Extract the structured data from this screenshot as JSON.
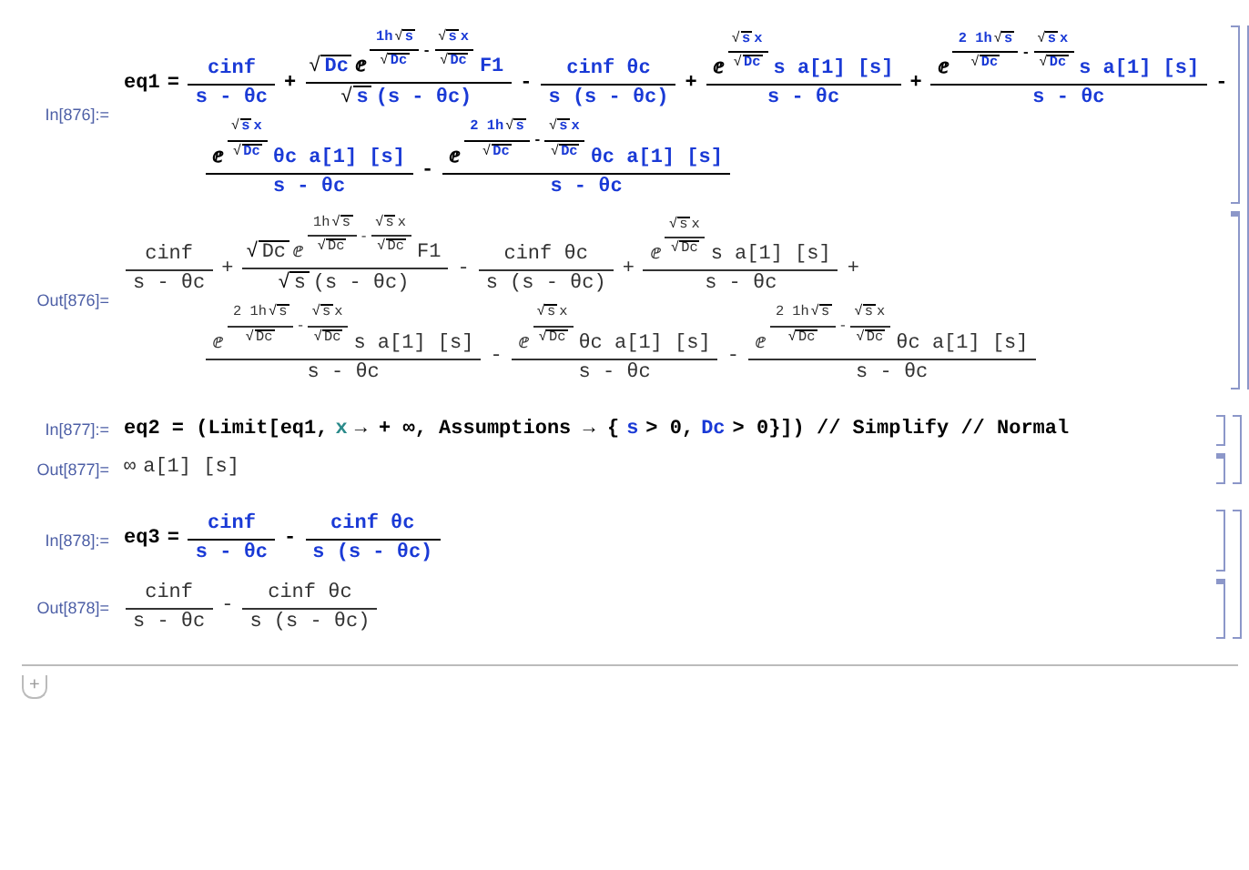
{
  "groups": [
    {
      "cells": [
        {
          "kind": "input",
          "label": "In[876]:=",
          "lines": [
            [
              {
                "op": "eq1"
              },
              {
                "op": "="
              },
              {
                "frac": {
                  "num": [
                    {
                      "var": "cinf"
                    }
                  ],
                  "den": [
                    {
                      "var": "s - θc"
                    }
                  ]
                }
              },
              {
                "op": "+"
              },
              {
                "frac": {
                  "num": [
                    {
                      "sqrt": {
                        "sign": "√",
                        "body": [
                          {
                            "var": "Dc"
                          }
                        ]
                      }
                    },
                    {
                      "power": {
                        "base": [
                          {
                            "op": "ⅇ"
                          }
                        ],
                        "exponent": [
                          {
                            "frac": {
                              "num": [
                                {
                                  "var": "1h"
                                },
                                {
                                  "sqrt": {
                                    "sign": "√",
                                    "body": [
                                      {
                                        "var": "s"
                                      }
                                    ]
                                  }
                                }
                              ],
                              "den": [
                                {
                                  "sqrt": {
                                    "sign": "√",
                                    "body": [
                                      {
                                        "var": "Dc"
                                      }
                                    ]
                                  }
                                }
                              ]
                            }
                          },
                          {
                            "op": "-"
                          },
                          {
                            "frac": {
                              "num": [
                                {
                                  "sqrt": {
                                    "sign": "√",
                                    "body": [
                                      {
                                        "var": "s"
                                      }
                                    ]
                                  }
                                },
                                {
                                  "var": "x"
                                }
                              ],
                              "den": [
                                {
                                  "sqrt": {
                                    "sign": "√",
                                    "body": [
                                      {
                                        "var": "Dc"
                                      }
                                    ]
                                  }
                                }
                              ]
                            }
                          }
                        ]
                      }
                    },
                    {
                      "var": "F1"
                    }
                  ],
                  "den": [
                    {
                      "sqrt": {
                        "sign": "√",
                        "body": [
                          {
                            "var": "s"
                          }
                        ]
                      }
                    },
                    {
                      "var": "(s - θc)"
                    }
                  ]
                }
              },
              {
                "op": "-"
              },
              {
                "frac": {
                  "num": [
                    {
                      "var": "cinf θc"
                    }
                  ],
                  "den": [
                    {
                      "var": "s (s - θc)"
                    }
                  ]
                }
              },
              {
                "op": "+"
              },
              {
                "frac": {
                  "num": [
                    {
                      "power": {
                        "base": [
                          {
                            "op": "ⅇ"
                          }
                        ],
                        "exponent": [
                          {
                            "frac": {
                              "num": [
                                {
                                  "sqrt": {
                                    "sign": "√",
                                    "body": [
                                      {
                                        "var": "s"
                                      }
                                    ]
                                  }
                                },
                                {
                                  "var": "x"
                                }
                              ],
                              "den": [
                                {
                                  "sqrt": {
                                    "sign": "√",
                                    "body": [
                                      {
                                        "var": "Dc"
                                      }
                                    ]
                                  }
                                }
                              ]
                            }
                          }
                        ]
                      }
                    },
                    {
                      "var": "s a[1] [s]"
                    }
                  ],
                  "den": [
                    {
                      "var": "s - θc"
                    }
                  ]
                }
              },
              {
                "op": "+"
              },
              {
                "frac": {
                  "num": [
                    {
                      "power": {
                        "base": [
                          {
                            "op": "ⅇ"
                          }
                        ],
                        "exponent": [
                          {
                            "frac": {
                              "num": [
                                {
                                  "var": "2 1h"
                                },
                                {
                                  "sqrt": {
                                    "sign": "√",
                                    "body": [
                                      {
                                        "var": "s"
                                      }
                                    ]
                                  }
                                }
                              ],
                              "den": [
                                {
                                  "sqrt": {
                                    "sign": "√",
                                    "body": [
                                      {
                                        "var": "Dc"
                                      }
                                    ]
                                  }
                                }
                              ]
                            }
                          },
                          {
                            "op": "-"
                          },
                          {
                            "frac": {
                              "num": [
                                {
                                  "sqrt": {
                                    "sign": "√",
                                    "body": [
                                      {
                                        "var": "s"
                                      }
                                    ]
                                  }
                                },
                                {
                                  "var": "x"
                                }
                              ],
                              "den": [
                                {
                                  "sqrt": {
                                    "sign": "√",
                                    "body": [
                                      {
                                        "var": "Dc"
                                      }
                                    ]
                                  }
                                }
                              ]
                            }
                          }
                        ]
                      }
                    },
                    {
                      "var": "s a[1] [s]"
                    }
                  ],
                  "den": [
                    {
                      "var": "s - θc"
                    }
                  ]
                }
              },
              {
                "op": "-"
              }
            ],
            [
              {
                "frac": {
                  "num": [
                    {
                      "power": {
                        "base": [
                          {
                            "op": "ⅇ"
                          }
                        ],
                        "exponent": [
                          {
                            "frac": {
                              "num": [
                                {
                                  "sqrt": {
                                    "sign": "√",
                                    "body": [
                                      {
                                        "var": "s"
                                      }
                                    ]
                                  }
                                },
                                {
                                  "var": "x"
                                }
                              ],
                              "den": [
                                {
                                  "sqrt": {
                                    "sign": "√",
                                    "body": [
                                      {
                                        "var": "Dc"
                                      }
                                    ]
                                  }
                                }
                              ]
                            }
                          }
                        ]
                      }
                    },
                    {
                      "var": "θc a[1] [s]"
                    }
                  ],
                  "den": [
                    {
                      "var": "s - θc"
                    }
                  ]
                }
              },
              {
                "op": "-"
              },
              {
                "frac": {
                  "num": [
                    {
                      "power": {
                        "base": [
                          {
                            "op": "ⅇ"
                          }
                        ],
                        "exponent": [
                          {
                            "frac": {
                              "num": [
                                {
                                  "var": "2 1h"
                                },
                                {
                                  "sqrt": {
                                    "sign": "√",
                                    "body": [
                                      {
                                        "var": "s"
                                      }
                                    ]
                                  }
                                }
                              ],
                              "den": [
                                {
                                  "sqrt": {
                                    "sign": "√",
                                    "body": [
                                      {
                                        "var": "Dc"
                                      }
                                    ]
                                  }
                                }
                              ]
                            }
                          },
                          {
                            "op": "-"
                          },
                          {
                            "frac": {
                              "num": [
                                {
                                  "sqrt": {
                                    "sign": "√",
                                    "body": [
                                      {
                                        "var": "s"
                                      }
                                    ]
                                  }
                                },
                                {
                                  "var": "x"
                                }
                              ],
                              "den": [
                                {
                                  "sqrt": {
                                    "sign": "√",
                                    "body": [
                                      {
                                        "var": "Dc"
                                      }
                                    ]
                                  }
                                }
                              ]
                            }
                          }
                        ]
                      }
                    },
                    {
                      "var": "θc a[1] [s]"
                    }
                  ],
                  "den": [
                    {
                      "var": "s - θc"
                    }
                  ]
                }
              }
            ]
          ]
        },
        {
          "kind": "output",
          "label": "Out[876]=",
          "lines": [
            [
              {
                "frac": {
                  "num": [
                    {
                      "var": "cinf"
                    }
                  ],
                  "den": [
                    {
                      "var": "s - θc"
                    }
                  ]
                }
              },
              {
                "op": "+"
              },
              {
                "frac": {
                  "num": [
                    {
                      "sqrt": {
                        "sign": "√",
                        "body": [
                          {
                            "var": "Dc"
                          }
                        ]
                      }
                    },
                    {
                      "power": {
                        "base": [
                          {
                            "op": "ⅇ"
                          }
                        ],
                        "exponent": [
                          {
                            "frac": {
                              "num": [
                                {
                                  "var": "1h"
                                },
                                {
                                  "sqrt": {
                                    "sign": "√",
                                    "body": [
                                      {
                                        "var": "s"
                                      }
                                    ]
                                  }
                                }
                              ],
                              "den": [
                                {
                                  "sqrt": {
                                    "sign": "√",
                                    "body": [
                                      {
                                        "var": "Dc"
                                      }
                                    ]
                                  }
                                }
                              ]
                            }
                          },
                          {
                            "op": "-"
                          },
                          {
                            "frac": {
                              "num": [
                                {
                                  "sqrt": {
                                    "sign": "√",
                                    "body": [
                                      {
                                        "var": "s"
                                      }
                                    ]
                                  }
                                },
                                {
                                  "var": "x"
                                }
                              ],
                              "den": [
                                {
                                  "sqrt": {
                                    "sign": "√",
                                    "body": [
                                      {
                                        "var": "Dc"
                                      }
                                    ]
                                  }
                                }
                              ]
                            }
                          }
                        ]
                      }
                    },
                    {
                      "var": "F1"
                    }
                  ],
                  "den": [
                    {
                      "sqrt": {
                        "sign": "√",
                        "body": [
                          {
                            "var": "s"
                          }
                        ]
                      }
                    },
                    {
                      "var": "(s - θc)"
                    }
                  ]
                }
              },
              {
                "op": "-"
              },
              {
                "frac": {
                  "num": [
                    {
                      "var": "cinf θc"
                    }
                  ],
                  "den": [
                    {
                      "var": "s (s - θc)"
                    }
                  ]
                }
              },
              {
                "op": "+"
              },
              {
                "frac": {
                  "num": [
                    {
                      "power": {
                        "base": [
                          {
                            "op": "ⅇ"
                          }
                        ],
                        "exponent": [
                          {
                            "frac": {
                              "num": [
                                {
                                  "sqrt": {
                                    "sign": "√",
                                    "body": [
                                      {
                                        "var": "s"
                                      }
                                    ]
                                  }
                                },
                                {
                                  "var": "x"
                                }
                              ],
                              "den": [
                                {
                                  "sqrt": {
                                    "sign": "√",
                                    "body": [
                                      {
                                        "var": "Dc"
                                      }
                                    ]
                                  }
                                }
                              ]
                            }
                          }
                        ]
                      }
                    },
                    {
                      "var": "s a[1] [s]"
                    }
                  ],
                  "den": [
                    {
                      "var": "s - θc"
                    }
                  ]
                }
              },
              {
                "op": "+"
              }
            ],
            [
              {
                "frac": {
                  "num": [
                    {
                      "power": {
                        "base": [
                          {
                            "op": "ⅇ"
                          }
                        ],
                        "exponent": [
                          {
                            "frac": {
                              "num": [
                                {
                                  "var": "2 1h"
                                },
                                {
                                  "sqrt": {
                                    "sign": "√",
                                    "body": [
                                      {
                                        "var": "s"
                                      }
                                    ]
                                  }
                                }
                              ],
                              "den": [
                                {
                                  "sqrt": {
                                    "sign": "√",
                                    "body": [
                                      {
                                        "var": "Dc"
                                      }
                                    ]
                                  }
                                }
                              ]
                            }
                          },
                          {
                            "op": "-"
                          },
                          {
                            "frac": {
                              "num": [
                                {
                                  "sqrt": {
                                    "sign": "√",
                                    "body": [
                                      {
                                        "var": "s"
                                      }
                                    ]
                                  }
                                },
                                {
                                  "var": "x"
                                }
                              ],
                              "den": [
                                {
                                  "sqrt": {
                                    "sign": "√",
                                    "body": [
                                      {
                                        "var": "Dc"
                                      }
                                    ]
                                  }
                                }
                              ]
                            }
                          }
                        ]
                      }
                    },
                    {
                      "var": "s a[1] [s]"
                    }
                  ],
                  "den": [
                    {
                      "var": "s - θc"
                    }
                  ]
                }
              },
              {
                "op": "-"
              },
              {
                "frac": {
                  "num": [
                    {
                      "power": {
                        "base": [
                          {
                            "op": "ⅇ"
                          }
                        ],
                        "exponent": [
                          {
                            "frac": {
                              "num": [
                                {
                                  "sqrt": {
                                    "sign": "√",
                                    "body": [
                                      {
                                        "var": "s"
                                      }
                                    ]
                                  }
                                },
                                {
                                  "var": "x"
                                }
                              ],
                              "den": [
                                {
                                  "sqrt": {
                                    "sign": "√",
                                    "body": [
                                      {
                                        "var": "Dc"
                                      }
                                    ]
                                  }
                                }
                              ]
                            }
                          }
                        ]
                      }
                    },
                    {
                      "var": "θc a[1] [s]"
                    }
                  ],
                  "den": [
                    {
                      "var": "s - θc"
                    }
                  ]
                }
              },
              {
                "op": "-"
              },
              {
                "frac": {
                  "num": [
                    {
                      "power": {
                        "base": [
                          {
                            "op": "ⅇ"
                          }
                        ],
                        "exponent": [
                          {
                            "frac": {
                              "num": [
                                {
                                  "var": "2 1h"
                                },
                                {
                                  "sqrt": {
                                    "sign": "√",
                                    "body": [
                                      {
                                        "var": "s"
                                      }
                                    ]
                                  }
                                }
                              ],
                              "den": [
                                {
                                  "sqrt": {
                                    "sign": "√",
                                    "body": [
                                      {
                                        "var": "Dc"
                                      }
                                    ]
                                  }
                                }
                              ]
                            }
                          },
                          {
                            "op": "-"
                          },
                          {
                            "frac": {
                              "num": [
                                {
                                  "sqrt": {
                                    "sign": "√",
                                    "body": [
                                      {
                                        "var": "s"
                                      }
                                    ]
                                  }
                                },
                                {
                                  "var": "x"
                                }
                              ],
                              "den": [
                                {
                                  "sqrt": {
                                    "sign": "√",
                                    "body": [
                                      {
                                        "var": "Dc"
                                      }
                                    ]
                                  }
                                }
                              ]
                            }
                          }
                        ]
                      }
                    },
                    {
                      "var": "θc a[1] [s]"
                    }
                  ],
                  "den": [
                    {
                      "var": "s - θc"
                    }
                  ]
                }
              }
            ]
          ]
        }
      ]
    },
    {
      "cells": [
        {
          "kind": "input",
          "label": "In[877]:=",
          "lines": [
            [
              {
                "op": "eq2 = (Limit[eq1,"
              },
              {
                "local": "x"
              },
              {
                "op": "→ + ∞, Assumptions → {"
              },
              {
                "var": "s"
              },
              {
                "op": "> 0,"
              },
              {
                "var": "Dc"
              },
              {
                "op": "> 0}]) // Simplify // Normal"
              }
            ]
          ]
        },
        {
          "kind": "output",
          "label": "Out[877]=",
          "lines": [
            [
              {
                "op": "∞"
              },
              {
                "var": "a[1] [s]"
              }
            ]
          ]
        }
      ]
    },
    {
      "cells": [
        {
          "kind": "input",
          "label": "In[878]:=",
          "lines": [
            [
              {
                "op": "eq3"
              },
              {
                "op": "="
              },
              {
                "frac": {
                  "num": [
                    {
                      "var": "cinf"
                    }
                  ],
                  "den": [
                    {
                      "var": "s - θc"
                    }
                  ]
                }
              },
              {
                "op": "-"
              },
              {
                "frac": {
                  "num": [
                    {
                      "var": "cinf θc"
                    }
                  ],
                  "den": [
                    {
                      "var": "s (s - θc)"
                    }
                  ]
                }
              }
            ]
          ]
        },
        {
          "kind": "output",
          "label": "Out[878]=",
          "lines": [
            [
              {
                "frac": {
                  "num": [
                    {
                      "var": "cinf"
                    }
                  ],
                  "den": [
                    {
                      "var": "s - θc"
                    }
                  ]
                }
              },
              {
                "op": "-"
              },
              {
                "frac": {
                  "num": [
                    {
                      "var": "cinf θc"
                    }
                  ],
                  "den": [
                    {
                      "var": "s (s - θc)"
                    }
                  ]
                }
              }
            ]
          ]
        }
      ]
    }
  ],
  "new_cell_button": "+"
}
